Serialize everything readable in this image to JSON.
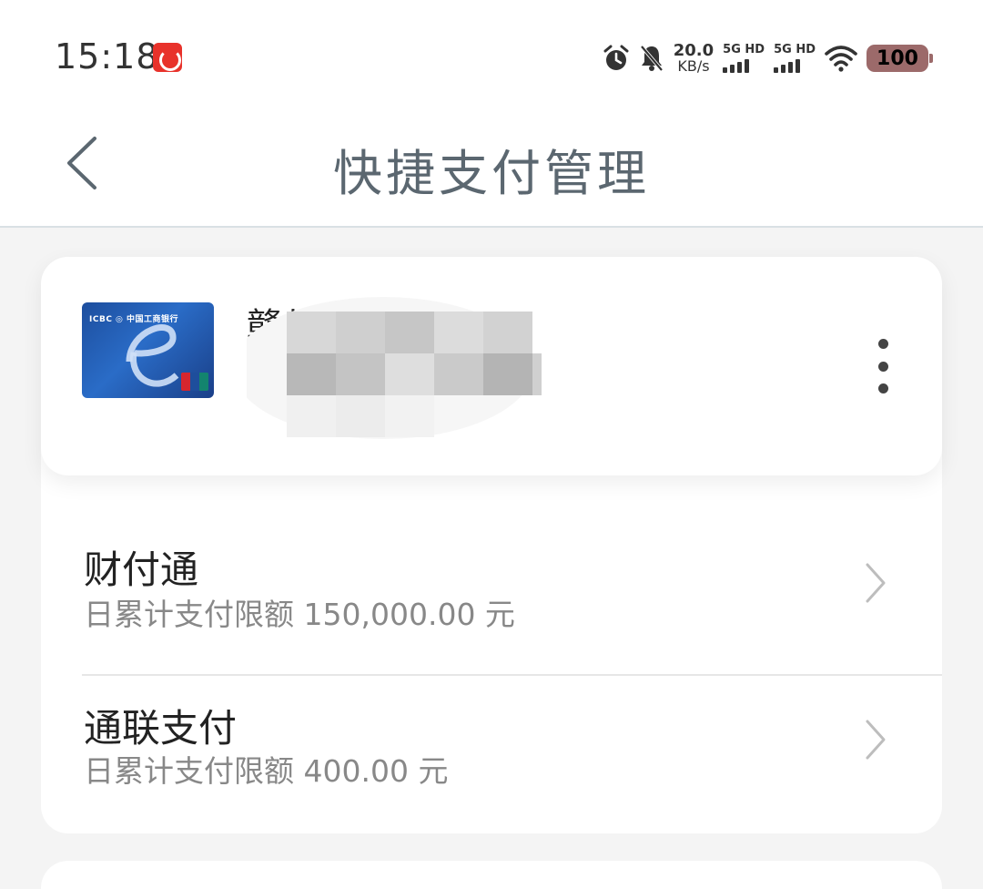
{
  "status_bar": {
    "time": "15:18",
    "speed_value": "20.0",
    "speed_unit": "KB/s",
    "sim1_label": "5G HD",
    "sim2_label": "5G HD",
    "battery": "100",
    "icons": [
      "netease-music-icon",
      "alarm-clock-icon",
      "bell-off-icon",
      "signal-icon",
      "wifi-icon",
      "battery-icon"
    ]
  },
  "header": {
    "title": "快捷支付管理"
  },
  "card": {
    "name_visible": "赣州 借记"
  },
  "payment_channels": [
    {
      "name": "财付通",
      "limit_text": "日累计支付限额 150,000.00 元"
    },
    {
      "name": "通联支付",
      "limit_text": "日累计支付限额 400.00 元"
    }
  ],
  "colors": {
    "title": "#5b6770",
    "card_blue": "#1d4e9e",
    "alert_red": "#e8322b"
  }
}
